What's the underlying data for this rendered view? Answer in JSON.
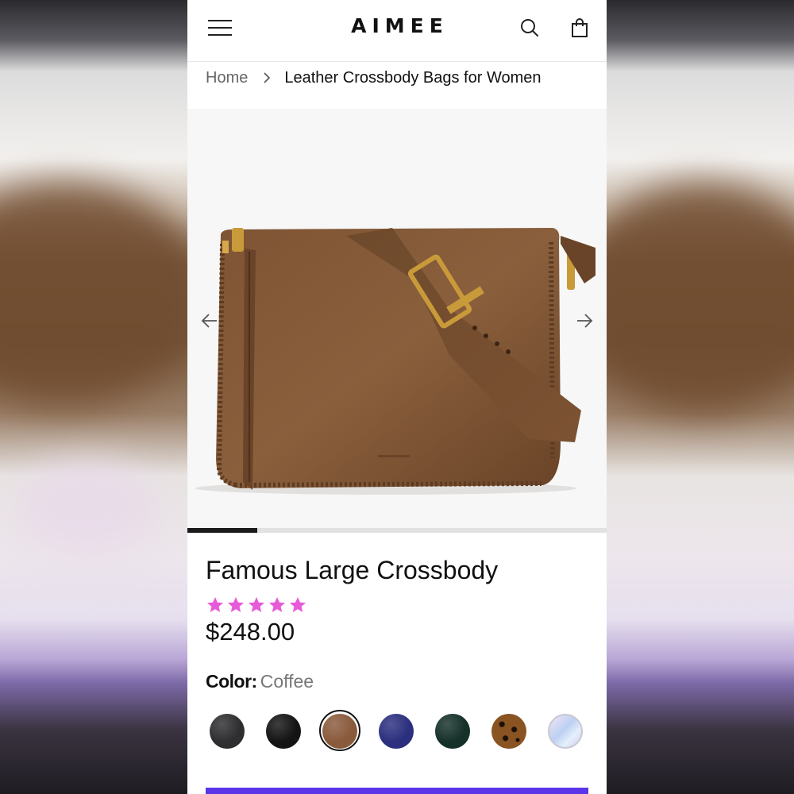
{
  "brand": {
    "logo": "AIMEE"
  },
  "header": {
    "menu_icon": "hamburger-menu-icon",
    "search_icon": "search-icon",
    "cart_icon": "shopping-bag-icon"
  },
  "breadcrumb": {
    "home": "Home",
    "current": "Leather Crossbody Bags for Women"
  },
  "gallery": {
    "prev_icon": "arrow-left-icon",
    "next_icon": "arrow-right-icon",
    "progress_fraction": 0.167
  },
  "product": {
    "title": "Famous Large Crossbody",
    "rating": 5,
    "rating_max": 5,
    "star_color": "#e85bd8",
    "price": "$248.00",
    "color_label": "Color:",
    "color_value": "Coffee"
  },
  "swatches": [
    {
      "name": "swatch-charcoal",
      "color": "#2e2e30",
      "selected": false
    },
    {
      "name": "swatch-black",
      "color": "#141414",
      "selected": false
    },
    {
      "name": "swatch-coffee",
      "color": "#8a5a3c",
      "selected": true
    },
    {
      "name": "swatch-navy",
      "color": "#2b2f7e",
      "selected": false
    },
    {
      "name": "swatch-dark-green",
      "color": "#16302a",
      "selected": false
    },
    {
      "name": "swatch-leopard",
      "color": "#8a5322",
      "selected": false
    },
    {
      "name": "swatch-iridescent",
      "color": "#c9d6f0",
      "selected": false
    }
  ],
  "accent_color": "#5b36e8"
}
